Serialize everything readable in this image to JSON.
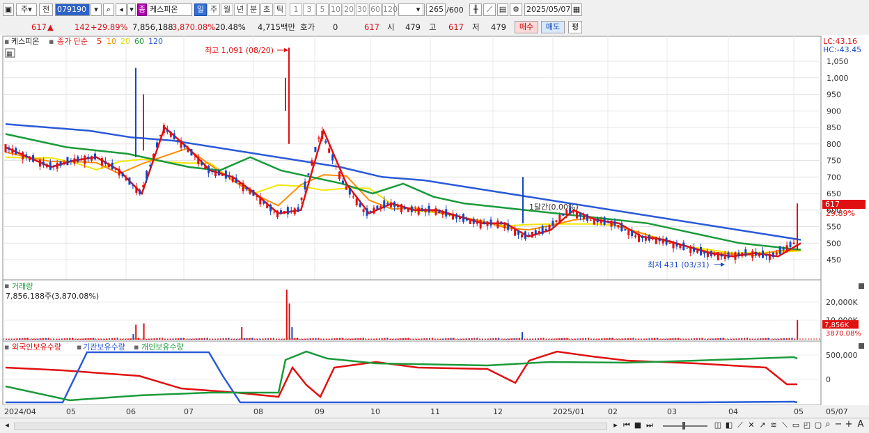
{
  "toolbar": {
    "mode1": "주",
    "mode2": "전",
    "code": "079190",
    "name": "케스피온",
    "name_badge": "종",
    "periods": [
      {
        "label": "일",
        "active": true
      },
      {
        "label": "주"
      },
      {
        "label": "월"
      },
      {
        "label": "년"
      },
      {
        "label": "분"
      },
      {
        "label": "초"
      },
      {
        "label": "틱"
      }
    ],
    "intervals": [
      "1",
      "3",
      "5",
      "10",
      "20",
      "30",
      "60",
      "120"
    ],
    "count": "265",
    "count_max": "/600",
    "date": "2025/05/07"
  },
  "quote": {
    "price": "617",
    "change": "142",
    "change_pct": "+29.89%",
    "volume": "7,856,188",
    "volume_ratio": "3,870.08%",
    "turnover": "20.48%",
    "amount": "4,715백만",
    "hoga_label": "호가",
    "hoga_value": "0",
    "hoga_price": "617",
    "open_label": "시",
    "open": "479",
    "high_label": "고",
    "high": "617",
    "low_label": "저",
    "low": "479",
    "buy": "매수",
    "sell": "매도",
    "eval": "평"
  },
  "chart": {
    "legend_name": "케스피온",
    "legend_base": "종가 단순",
    "ma_periods": [
      "5",
      "10",
      "20",
      "60",
      "120"
    ],
    "lc": "LC:43.16",
    "hc": "HC:-43.45",
    "high_label": "최고 1,091 (08/20)",
    "low_label": "최저 431 (03/31)",
    "last_price": "617",
    "last_pct": "29.89%",
    "prev_high_label": "1달간(0.00%)",
    "volume_title": "거래량",
    "volume_value": "7,856,188주(3,870.08%)",
    "volume_last": "7,856K",
    "volume_last_pct": "3870.08%",
    "holder_titles": [
      "외국인보유수량",
      "기관보유수량",
      "개인보유수량"
    ],
    "colors": {
      "ma5": "#e01010",
      "ma10": "#ff8c00",
      "ma20": "#f2e600",
      "ma60": "#1a9a3a",
      "ma120": "#2a5ad8",
      "up": "#e01010",
      "down": "#1446c8"
    }
  },
  "chart_data": [
    {
      "type": "candlestick",
      "title": "케스피온",
      "y_ticks": [
        450,
        500,
        550,
        600,
        650,
        700,
        750,
        800,
        850,
        900,
        950,
        1000,
        1050
      ],
      "x_ticks": [
        "2024/04",
        "05",
        "06",
        "07",
        "08",
        "09",
        "10",
        "11",
        "12",
        "2025/01",
        "02",
        "03",
        "04",
        "05",
        "05/07"
      ],
      "series": [
        {
          "name": "5",
          "approx_values": [
            790,
            760,
            730,
            750,
            760,
            720,
            650,
            850,
            790,
            720,
            700,
            650,
            590,
            600,
            840,
            680,
            590,
            620,
            600,
            600,
            580,
            560,
            560,
            520,
            540,
            600,
            570,
            560,
            520,
            510,
            490,
            470,
            460,
            470,
            460,
            500
          ]
        },
        {
          "name": "60",
          "approx_values": [
            830,
            810,
            790,
            780,
            770,
            750,
            730,
            720,
            760,
            720,
            700,
            680,
            650,
            680,
            640,
            620,
            610,
            600,
            590,
            580,
            570,
            560,
            540,
            520,
            500,
            490,
            480
          ]
        },
        {
          "name": "120",
          "approx_values": [
            860,
            850,
            840,
            820,
            810,
            790,
            770,
            750,
            730,
            700,
            690,
            670,
            650,
            630,
            610,
            590,
            570,
            550,
            530,
            510
          ]
        }
      ],
      "annotations": {
        "max": {
          "value": 1091,
          "date": "08/20"
        },
        "min": {
          "value": 431,
          "date": "03/31"
        },
        "last": 617
      }
    },
    {
      "type": "bar",
      "title": "거래량",
      "y_ticks": [
        "10,000K",
        "20,000K"
      ],
      "last_value": 7856188
    },
    {
      "type": "line",
      "title": "보유수량",
      "series": [
        {
          "name": "외국인보유수량"
        },
        {
          "name": "기관보유수량"
        },
        {
          "name": "개인보유수량"
        }
      ],
      "y_ticks": [
        "0",
        "500,000"
      ]
    }
  ]
}
